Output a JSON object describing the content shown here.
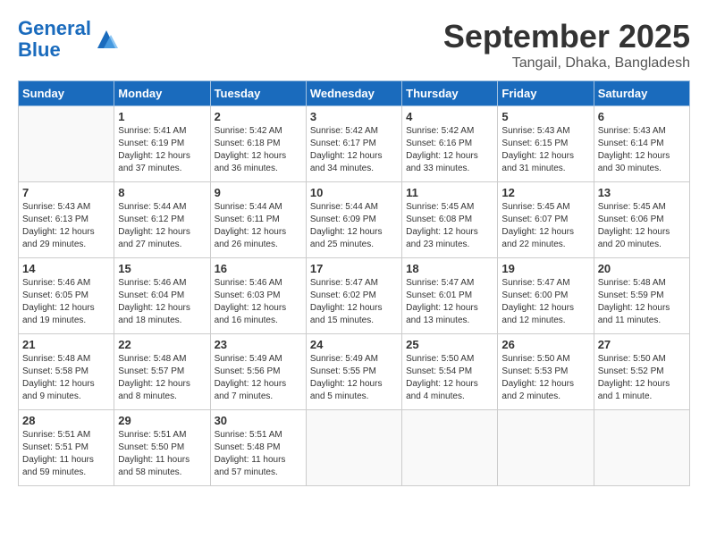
{
  "header": {
    "logo_line1": "General",
    "logo_line2": "Blue",
    "title": "September 2025",
    "subtitle": "Tangail, Dhaka, Bangladesh"
  },
  "calendar": {
    "headers": [
      "Sunday",
      "Monday",
      "Tuesday",
      "Wednesday",
      "Thursday",
      "Friday",
      "Saturday"
    ],
    "weeks": [
      [
        {
          "day": "",
          "info": ""
        },
        {
          "day": "1",
          "info": "Sunrise: 5:41 AM\nSunset: 6:19 PM\nDaylight: 12 hours\nand 37 minutes."
        },
        {
          "day": "2",
          "info": "Sunrise: 5:42 AM\nSunset: 6:18 PM\nDaylight: 12 hours\nand 36 minutes."
        },
        {
          "day": "3",
          "info": "Sunrise: 5:42 AM\nSunset: 6:17 PM\nDaylight: 12 hours\nand 34 minutes."
        },
        {
          "day": "4",
          "info": "Sunrise: 5:42 AM\nSunset: 6:16 PM\nDaylight: 12 hours\nand 33 minutes."
        },
        {
          "day": "5",
          "info": "Sunrise: 5:43 AM\nSunset: 6:15 PM\nDaylight: 12 hours\nand 31 minutes."
        },
        {
          "day": "6",
          "info": "Sunrise: 5:43 AM\nSunset: 6:14 PM\nDaylight: 12 hours\nand 30 minutes."
        }
      ],
      [
        {
          "day": "7",
          "info": "Sunrise: 5:43 AM\nSunset: 6:13 PM\nDaylight: 12 hours\nand 29 minutes."
        },
        {
          "day": "8",
          "info": "Sunrise: 5:44 AM\nSunset: 6:12 PM\nDaylight: 12 hours\nand 27 minutes."
        },
        {
          "day": "9",
          "info": "Sunrise: 5:44 AM\nSunset: 6:11 PM\nDaylight: 12 hours\nand 26 minutes."
        },
        {
          "day": "10",
          "info": "Sunrise: 5:44 AM\nSunset: 6:09 PM\nDaylight: 12 hours\nand 25 minutes."
        },
        {
          "day": "11",
          "info": "Sunrise: 5:45 AM\nSunset: 6:08 PM\nDaylight: 12 hours\nand 23 minutes."
        },
        {
          "day": "12",
          "info": "Sunrise: 5:45 AM\nSunset: 6:07 PM\nDaylight: 12 hours\nand 22 minutes."
        },
        {
          "day": "13",
          "info": "Sunrise: 5:45 AM\nSunset: 6:06 PM\nDaylight: 12 hours\nand 20 minutes."
        }
      ],
      [
        {
          "day": "14",
          "info": "Sunrise: 5:46 AM\nSunset: 6:05 PM\nDaylight: 12 hours\nand 19 minutes."
        },
        {
          "day": "15",
          "info": "Sunrise: 5:46 AM\nSunset: 6:04 PM\nDaylight: 12 hours\nand 18 minutes."
        },
        {
          "day": "16",
          "info": "Sunrise: 5:46 AM\nSunset: 6:03 PM\nDaylight: 12 hours\nand 16 minutes."
        },
        {
          "day": "17",
          "info": "Sunrise: 5:47 AM\nSunset: 6:02 PM\nDaylight: 12 hours\nand 15 minutes."
        },
        {
          "day": "18",
          "info": "Sunrise: 5:47 AM\nSunset: 6:01 PM\nDaylight: 12 hours\nand 13 minutes."
        },
        {
          "day": "19",
          "info": "Sunrise: 5:47 AM\nSunset: 6:00 PM\nDaylight: 12 hours\nand 12 minutes."
        },
        {
          "day": "20",
          "info": "Sunrise: 5:48 AM\nSunset: 5:59 PM\nDaylight: 12 hours\nand 11 minutes."
        }
      ],
      [
        {
          "day": "21",
          "info": "Sunrise: 5:48 AM\nSunset: 5:58 PM\nDaylight: 12 hours\nand 9 minutes."
        },
        {
          "day": "22",
          "info": "Sunrise: 5:48 AM\nSunset: 5:57 PM\nDaylight: 12 hours\nand 8 minutes."
        },
        {
          "day": "23",
          "info": "Sunrise: 5:49 AM\nSunset: 5:56 PM\nDaylight: 12 hours\nand 7 minutes."
        },
        {
          "day": "24",
          "info": "Sunrise: 5:49 AM\nSunset: 5:55 PM\nDaylight: 12 hours\nand 5 minutes."
        },
        {
          "day": "25",
          "info": "Sunrise: 5:50 AM\nSunset: 5:54 PM\nDaylight: 12 hours\nand 4 minutes."
        },
        {
          "day": "26",
          "info": "Sunrise: 5:50 AM\nSunset: 5:53 PM\nDaylight: 12 hours\nand 2 minutes."
        },
        {
          "day": "27",
          "info": "Sunrise: 5:50 AM\nSunset: 5:52 PM\nDaylight: 12 hours\nand 1 minute."
        }
      ],
      [
        {
          "day": "28",
          "info": "Sunrise: 5:51 AM\nSunset: 5:51 PM\nDaylight: 11 hours\nand 59 minutes."
        },
        {
          "day": "29",
          "info": "Sunrise: 5:51 AM\nSunset: 5:50 PM\nDaylight: 11 hours\nand 58 minutes."
        },
        {
          "day": "30",
          "info": "Sunrise: 5:51 AM\nSunset: 5:48 PM\nDaylight: 11 hours\nand 57 minutes."
        },
        {
          "day": "",
          "info": ""
        },
        {
          "day": "",
          "info": ""
        },
        {
          "day": "",
          "info": ""
        },
        {
          "day": "",
          "info": ""
        }
      ]
    ]
  }
}
